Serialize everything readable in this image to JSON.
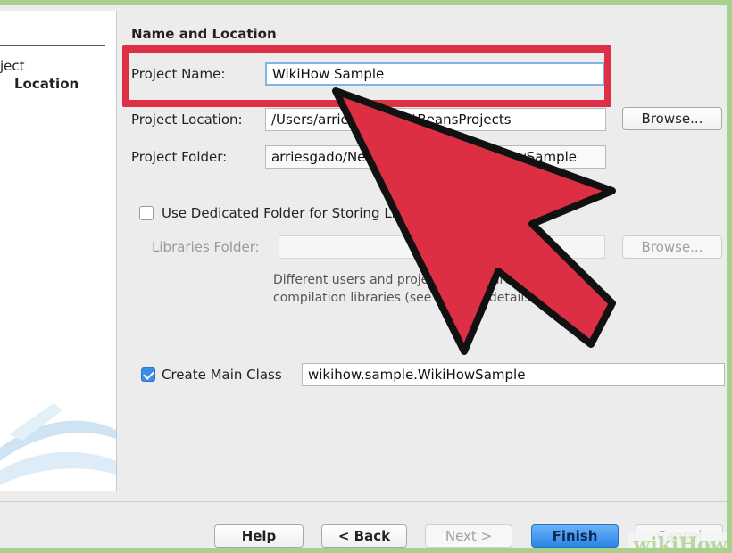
{
  "steps_panel": {
    "item_line1": "ject",
    "item_line2": "Location"
  },
  "section": {
    "heading": "Name and Location"
  },
  "form": {
    "project_name": {
      "label": "Project Name:",
      "value": "WikiHow Sample"
    },
    "project_location": {
      "label": "Project Location:",
      "value": "/Users/arriesgado/NetBeansProjects",
      "browse_label": "Browse..."
    },
    "project_folder": {
      "label": "Project Folder:",
      "value": "arriesgado/NetBeansProjects/WikiHowSample"
    },
    "dedicated_folder": {
      "label": "Use Dedicated Folder for Storing Libraries",
      "checked": false
    },
    "libraries_folder": {
      "label": "Libraries Folder:",
      "value": "",
      "browse_label": "Browse..."
    },
    "libraries_help": "Different users and projects can share the same compilation libraries (see Help for details).",
    "create_main_class": {
      "label": "Create Main Class",
      "checked": true,
      "value": "wikihow.sample.WikiHowSample"
    }
  },
  "footer": {
    "help_label": "Help",
    "back_label": "< Back",
    "next_label": "Next >",
    "finish_label": "Finish",
    "cancel_label": "Cancel"
  },
  "colors": {
    "frame_border": "#a9d18e",
    "highlight": "#dd3044",
    "arrow_fill": "#dc2f43",
    "primary_button": "#2a84e6"
  },
  "watermark": "wikiHow"
}
